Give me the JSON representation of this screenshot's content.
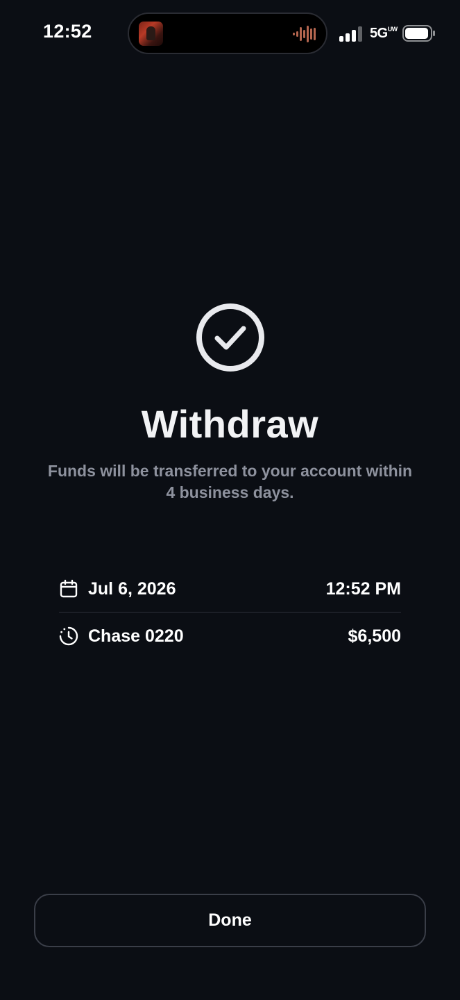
{
  "status_bar": {
    "time": "12:52",
    "network": "5G",
    "network_badge": "UW",
    "icons": [
      "album-art-icon",
      "audio-waveform-icon",
      "signal-bars-icon",
      "battery-icon"
    ]
  },
  "success": {
    "icon": "check-circle-icon",
    "title": "Withdraw",
    "subtitle": "Funds will be transferred to your account within 4 business days."
  },
  "details": {
    "date": {
      "icon": "calendar-icon",
      "label": "Jul 6, 2026",
      "value": "12:52 PM"
    },
    "account": {
      "icon": "clock-dashed-icon",
      "label": "Chase 0220",
      "value": "$6,500"
    }
  },
  "actions": {
    "done_label": "Done"
  },
  "colors": {
    "background": "#0b0e14",
    "text_primary": "#ffffff",
    "text_secondary": "#8e929e",
    "divider": "#2c303a",
    "button_border": "#3a3e48",
    "waveform_accent": "#b5664f"
  }
}
